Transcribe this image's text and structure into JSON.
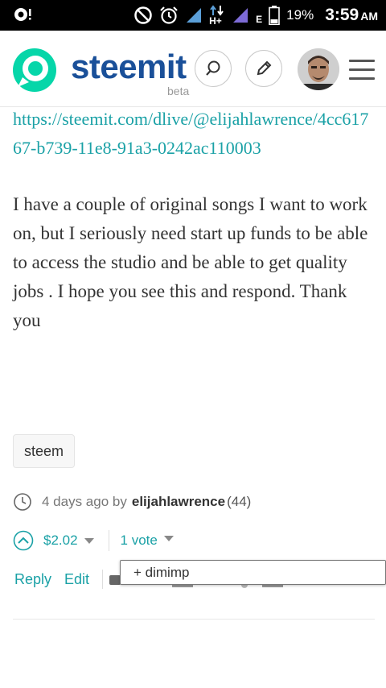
{
  "status_bar": {
    "battery": "19%",
    "time": "3:59",
    "ampm": "AM",
    "network_label": "H+",
    "network_label_2": "E"
  },
  "header": {
    "brand": "steemit",
    "beta": "beta",
    "colors": {
      "brand": "#1a5099",
      "logo": "#06d6a9",
      "accent": "#1aa1a6"
    }
  },
  "post": {
    "link": "https://steemit.com/dlive/@elijahlawrence/4cc61767-b739-11e8-91a3-0242ac110003",
    "body": "I have a couple of original songs I want to work on, but I seriously need start up funds to be able to access the studio and be able to get quality jobs . I hope you see this and respond. Thank you",
    "tag": "steem",
    "time_ago": "4 days ago by",
    "author": "elijahlawrence",
    "reputation": "(44)",
    "payout": "$2.02",
    "votes": "1 vote",
    "reply_label": "Reply",
    "edit_label": "Edit",
    "voter_popup": "+ dimimp"
  }
}
